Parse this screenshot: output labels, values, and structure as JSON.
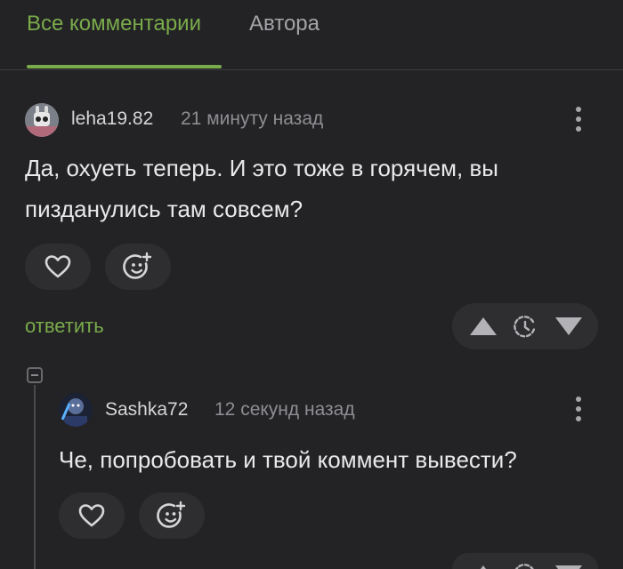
{
  "tabs": [
    {
      "label": "Все комментарии",
      "active": true
    },
    {
      "label": "Автора",
      "active": false
    }
  ],
  "comments": [
    {
      "username": "leha19.82",
      "time": "21 минуту назад",
      "text_lines": [
        "Да, охуеть теперь. И это тоже в горячем, вы",
        "пизданулись там совсем?"
      ],
      "reply_label": "ответить"
    },
    {
      "username": "Sashka72",
      "time": "12 секунд назад",
      "text_lines": [
        "Че, попробовать и твой коммент вывести?"
      ]
    }
  ],
  "colors": {
    "background": "#232325",
    "accent": "#7aab4b",
    "button_bg": "#2e2e31",
    "muted_text": "#8e8e93"
  },
  "icons": [
    "heart-icon",
    "emoji-add-icon",
    "kebab-icon",
    "vote-up-icon",
    "clock-icon",
    "vote-down-icon",
    "collapse-icon"
  ]
}
